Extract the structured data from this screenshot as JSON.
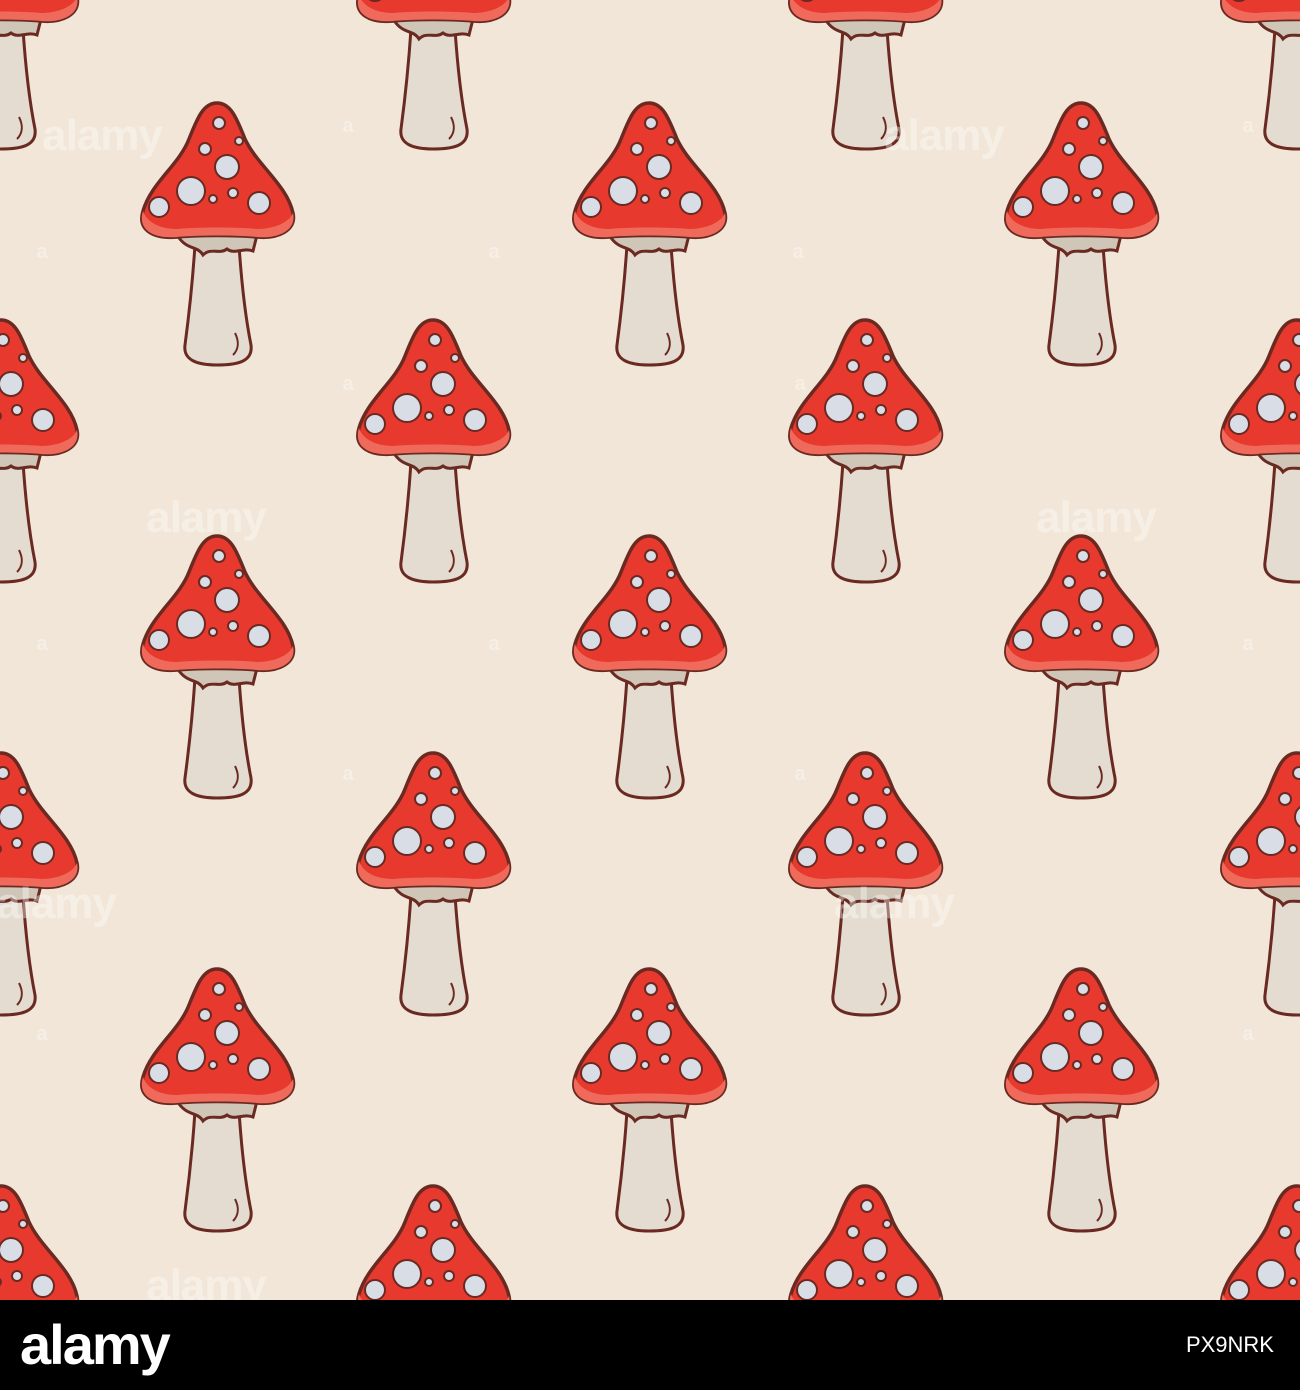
{
  "pattern": {
    "subject": "fly agaric mushroom",
    "icon": "mushroom-icon",
    "colors": {
      "background": "#f2e6d8",
      "cap": "#e8392f",
      "cap_shade": "#f06a5c",
      "spots": "#d8dde6",
      "stem": "#e4dcd0",
      "outline": "#6a2a22"
    }
  },
  "watermark": {
    "word": "alamy",
    "mark": "a"
  },
  "footer": {
    "brand": "alamy",
    "image_id_label": "",
    "image_id": "PX9NRK"
  }
}
